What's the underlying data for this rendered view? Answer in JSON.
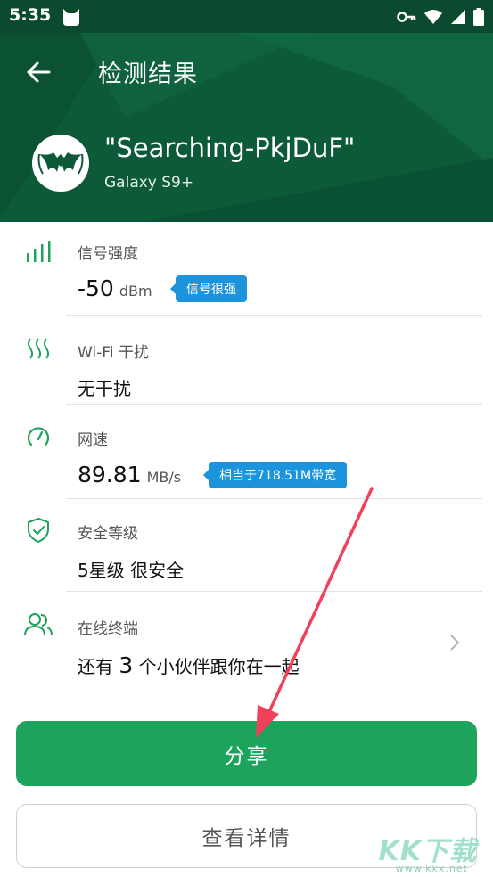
{
  "status_bar": {
    "time": "5:35"
  },
  "header": {
    "title": "检测结果",
    "ssid": "\"Searching-PkjDuF\"",
    "device_model": "Galaxy S9+"
  },
  "items": {
    "signal": {
      "label": "信号强度",
      "value": "-50",
      "unit": "dBm",
      "badge": "信号很强"
    },
    "interference": {
      "label": "Wi-Fi 干扰",
      "value": "无干扰"
    },
    "speed": {
      "label": "网速",
      "value": "89.81",
      "unit": "MB/s",
      "badge": "相当于718.51M带宽"
    },
    "security": {
      "label": "安全等级",
      "value": "5星级 很安全"
    },
    "online": {
      "label": "在线终端",
      "value_prefix": "还有",
      "value_count": "3",
      "value_suffix": "个小伙伴跟你在一起"
    }
  },
  "buttons": {
    "share": "分享",
    "details": "查看详情"
  },
  "watermark": {
    "brand": "KK下载",
    "url": "www.kkx.net"
  },
  "colors": {
    "header": "#0d5a38",
    "accent": "#1da35b",
    "badge": "#1b93dd",
    "annotation_arrow": "#f0405a"
  },
  "icons": {
    "status": [
      "cat-icon",
      "key-icon",
      "wifi-icon",
      "cell-signal-icon",
      "battery-icon"
    ],
    "rows": [
      "signal-bars-icon",
      "interference-waves-icon",
      "speedometer-icon",
      "shield-check-icon",
      "users-icon"
    ]
  }
}
